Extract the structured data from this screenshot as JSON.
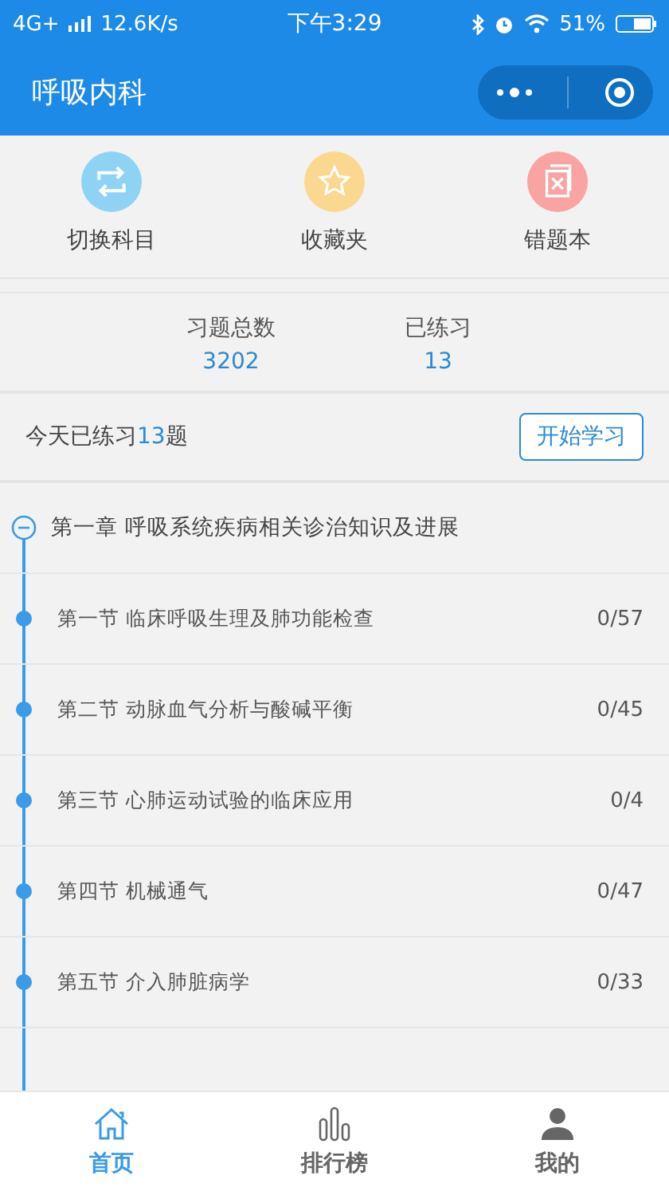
{
  "status_bar": {
    "network": "4G+",
    "speed": "12.6K/s",
    "time": "下午3:29",
    "battery": "51%"
  },
  "header": {
    "title": "呼吸内科"
  },
  "shortcuts": [
    {
      "label": "切换科目",
      "kind": "switch",
      "color": "#8fd3f4"
    },
    {
      "label": "收藏夹",
      "kind": "favorite",
      "color": "#fbd890"
    },
    {
      "label": "错题本",
      "kind": "mistakes",
      "color": "#f9a3a3"
    }
  ],
  "stats": [
    {
      "label": "习题总数",
      "value": "3202"
    },
    {
      "label": "已练习",
      "value": "13"
    }
  ],
  "today": {
    "prefix": "今天已练习",
    "count": "13",
    "suffix": "题",
    "button": "开始学习"
  },
  "chapter": {
    "title": "第一章 呼吸系统疾病相关诊治知识及进展",
    "expanded": true,
    "children": [
      {
        "title": "第一节 临床呼吸生理及肺功能检查",
        "progress": "0/57"
      },
      {
        "title": "第二节 动脉血气分析与酸碱平衡",
        "progress": "0/45"
      },
      {
        "title": "第三节 心肺运动试验的临床应用",
        "progress": "0/4"
      },
      {
        "title": "第四节 机械通气",
        "progress": "0/47"
      },
      {
        "title": "第五节 介入肺脏病学",
        "progress": "0/33"
      }
    ]
  },
  "tabs": [
    {
      "label": "首页",
      "kind": "home",
      "selected": true
    },
    {
      "label": "排行榜",
      "kind": "ranking",
      "selected": false
    },
    {
      "label": "我的",
      "kind": "profile",
      "selected": false
    }
  ]
}
